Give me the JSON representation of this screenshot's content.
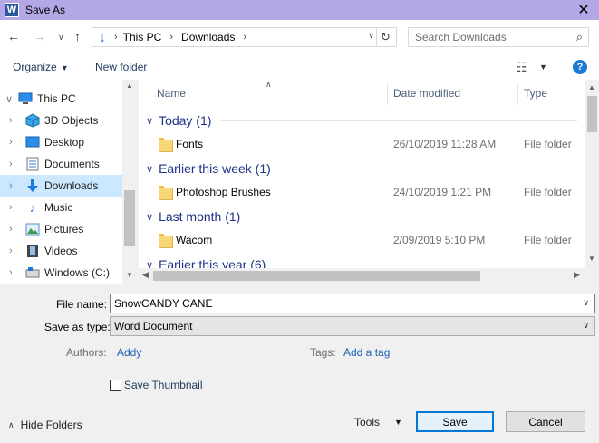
{
  "window": {
    "title": "Save As",
    "app_icon": "W",
    "close_glyph": "✕"
  },
  "address": {
    "crumbs": [
      "This PC",
      "Downloads"
    ],
    "search_placeholder": "Search Downloads"
  },
  "toolbar": {
    "organize_label": "Organize",
    "new_folder_label": "New folder",
    "help_label": "?"
  },
  "nav": {
    "items": [
      {
        "label": "This PC",
        "icon": "computer-icon"
      },
      {
        "label": "3D Objects",
        "icon": "3d-objects-icon"
      },
      {
        "label": "Desktop",
        "icon": "desktop-icon"
      },
      {
        "label": "Documents",
        "icon": "documents-icon"
      },
      {
        "label": "Downloads",
        "icon": "downloads-icon",
        "selected": true
      },
      {
        "label": "Music",
        "icon": "music-icon"
      },
      {
        "label": "Pictures",
        "icon": "pictures-icon"
      },
      {
        "label": "Videos",
        "icon": "videos-icon"
      },
      {
        "label": "Windows (C:)",
        "icon": "drive-icon"
      }
    ]
  },
  "files": {
    "columns": {
      "name": "Name",
      "date_modified": "Date modified",
      "type": "Type"
    },
    "groups": [
      {
        "title": "Today (1)",
        "rows": [
          {
            "name": "Fonts",
            "date": "26/10/2019 11:28 AM",
            "type": "File folder"
          }
        ]
      },
      {
        "title": "Earlier this week (1)",
        "rows": [
          {
            "name": "Photoshop Brushes",
            "date": "24/10/2019 1:21 PM",
            "type": "File folder"
          }
        ]
      },
      {
        "title": "Last month (1)",
        "rows": [
          {
            "name": "Wacom",
            "date": "2/09/2019 5:10 PM",
            "type": "File folder"
          }
        ]
      },
      {
        "title": "Earlier this year (6)",
        "rows": []
      }
    ]
  },
  "form": {
    "file_name_label": "File name:",
    "file_name_value": "SnowCANDY CANE",
    "save_type_label": "Save as type:",
    "save_type_value": "Word Document",
    "authors_label": "Authors:",
    "authors_value": "Addy",
    "tags_label": "Tags:",
    "tags_value": "Add a tag",
    "thumbnail_label": "Save Thumbnail",
    "thumbnail_checked": false
  },
  "footer": {
    "hide_folders_label": "Hide Folders",
    "tools_label": "Tools",
    "save_label": "Save",
    "cancel_label": "Cancel"
  },
  "colors": {
    "titlebar": "#b4a7e6",
    "selection": "#cce8ff",
    "group_heading": "#1e3287",
    "link": "#1e63b8",
    "primary_border": "#0078d7"
  }
}
